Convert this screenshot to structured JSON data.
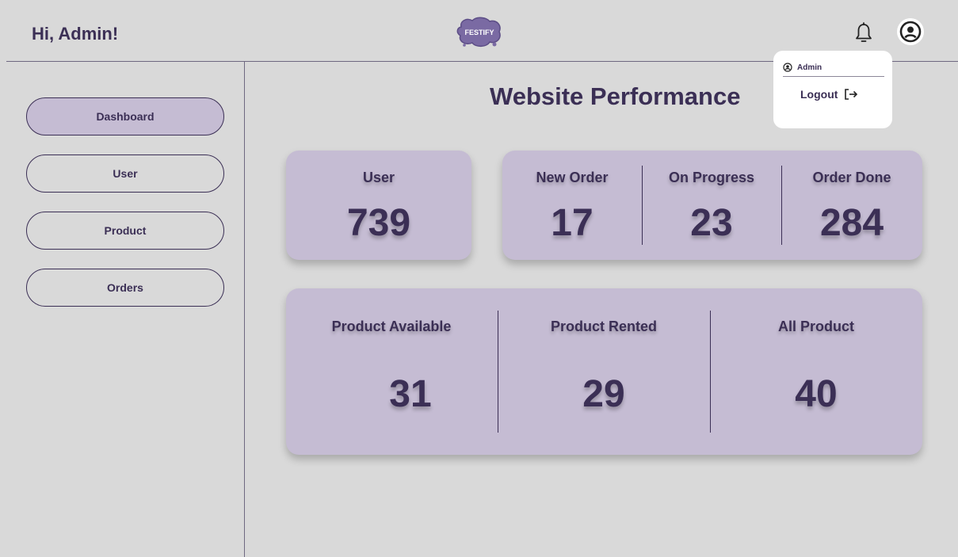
{
  "header": {
    "greeting": "Hi, Admin!",
    "logo_text": "FESTIFY",
    "icons": {
      "bell": "bell-icon",
      "avatar": "user-circle-icon"
    }
  },
  "dropdown": {
    "username": "Admin",
    "logout_label": "Logout"
  },
  "sidebar": {
    "items": [
      {
        "label": "Dashboard",
        "active": true
      },
      {
        "label": "User",
        "active": false
      },
      {
        "label": "Product",
        "active": false
      },
      {
        "label": "Orders",
        "active": false
      }
    ]
  },
  "main": {
    "title": "Website Performance",
    "user_card": {
      "label": "User",
      "value": "739"
    },
    "orders_card": {
      "new_order": {
        "label": "New Order",
        "value": "17"
      },
      "on_progress": {
        "label": "On Progress",
        "value": "23"
      },
      "order_done": {
        "label": "Order Done",
        "value": "284"
      }
    },
    "product_card": {
      "available": {
        "label": "Product Available",
        "value": "31"
      },
      "rented": {
        "label": "Product Rented",
        "value": "29"
      },
      "all": {
        "label": "All Product",
        "value": "40"
      }
    }
  },
  "colors": {
    "background": "#d9d9d9",
    "accent": "#c5bcd3",
    "text": "#3b2f55"
  }
}
